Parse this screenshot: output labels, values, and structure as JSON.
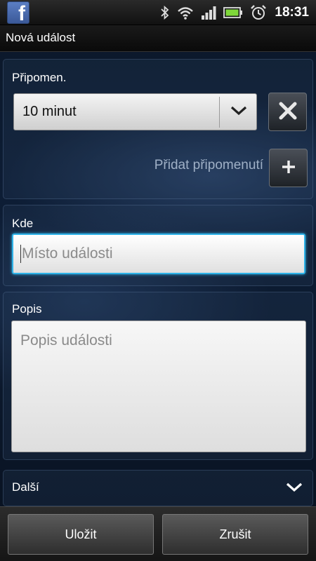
{
  "status_bar": {
    "time": "18:31",
    "icons": [
      "facebook-icon",
      "bluetooth-icon",
      "wifi-icon",
      "signal-icon",
      "battery-icon",
      "alarm-icon"
    ]
  },
  "title_bar": {
    "title": "Nová událost"
  },
  "reminder": {
    "label": "Připomen.",
    "selected": "10 minut",
    "add_label": "Přidat připomenutí"
  },
  "location": {
    "label": "Kde",
    "placeholder": "Místo události"
  },
  "description": {
    "label": "Popis",
    "placeholder": "Popis události"
  },
  "more": {
    "label": "Další"
  },
  "bottom_bar": {
    "save_label": "Uložit",
    "cancel_label": "Zrušit"
  },
  "colors": {
    "focus_border": "#2fb3e8",
    "facebook_blue": "#3b5998"
  }
}
